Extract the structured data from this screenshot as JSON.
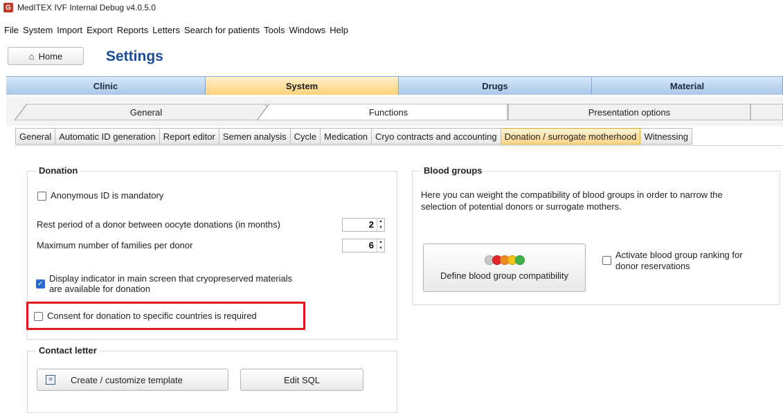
{
  "window": {
    "title": "MedITEX IVF Internal Debug v4.0.5.0"
  },
  "menu": [
    "File",
    "System",
    "Import",
    "Export",
    "Reports",
    "Letters",
    "Search for patients",
    "Tools",
    "Windows",
    "Help"
  ],
  "header": {
    "home_label": "Home",
    "page_title": "Settings"
  },
  "main_tabs": [
    "Clinic",
    "System",
    "Drugs",
    "Material"
  ],
  "sub_tabs": [
    "General",
    "Functions",
    "Presentation options"
  ],
  "third_tabs": [
    "General",
    "Automatic ID generation",
    "Report editor",
    "Semen analysis",
    "Cycle",
    "Medication",
    "Cryo contracts and accounting",
    "Donation / surrogate motherhood",
    "Witnessing"
  ],
  "donation": {
    "legend": "Donation",
    "anonymous_label": "Anonymous ID is mandatory",
    "anonymous_checked": false,
    "rest_period_label": "Rest period of a donor between oocyte donations (in months)",
    "rest_period_value": "2",
    "max_families_label": "Maximum number of families per donor",
    "max_families_value": "6",
    "display_indicator_label_1": "Display indicator in main screen that cryopreserved materials",
    "display_indicator_label_2": "are available for donation",
    "display_indicator_checked": true,
    "consent_label": "Consent for donation to specific countries is required",
    "consent_checked": false
  },
  "contact_letter": {
    "legend": "Contact letter",
    "create_button": "Create / customize template",
    "edit_sql_button": "Edit SQL"
  },
  "blood_groups": {
    "legend": "Blood groups",
    "description_1": "Here you can weight the compatibility of blood groups in order to narrow the",
    "description_2": "selection of potential donors or surrogate mothers.",
    "define_button": "Define blood group compatibility",
    "activate_label_1": "Activate blood group ranking for",
    "activate_label_2": "donor reservations",
    "activate_checked": false,
    "dot_colors": [
      "#c8c8c8",
      "#e0262a",
      "#f08a1e",
      "#f2c21a",
      "#3fb04a"
    ]
  },
  "colors": {
    "title_blue": "#1b4c9a",
    "highlight_red": "#e0191f",
    "active_tab": "#ffd27a"
  }
}
